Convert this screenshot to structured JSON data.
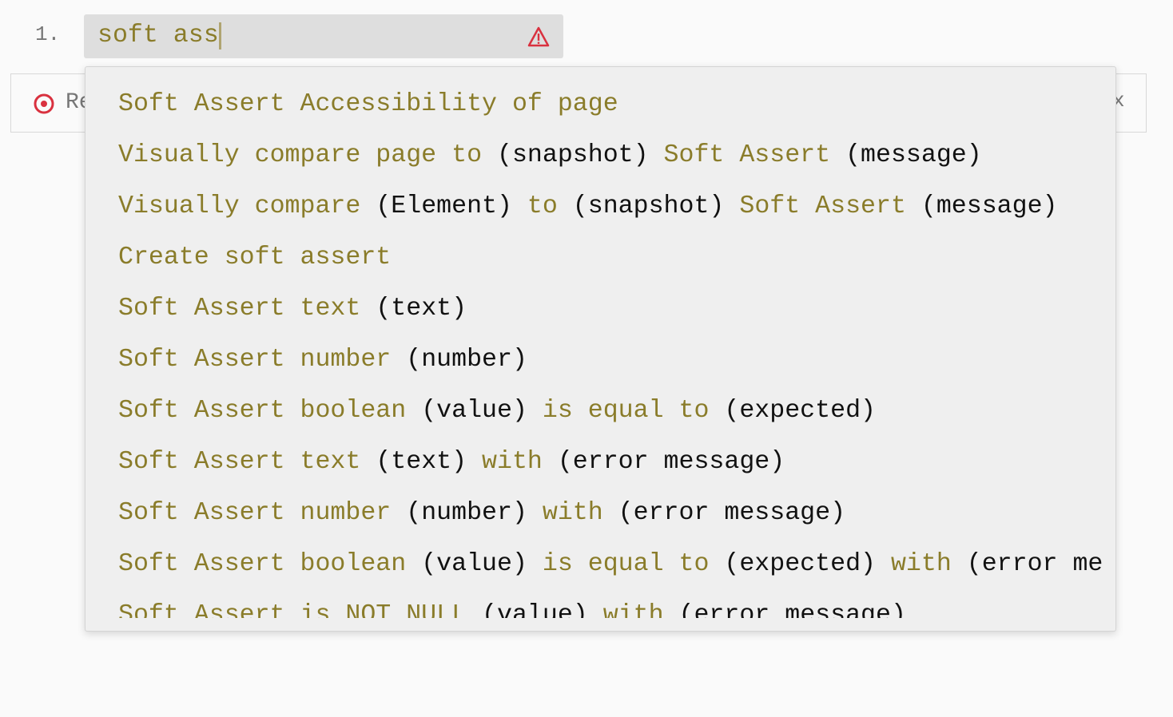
{
  "step_number": "1.",
  "input": {
    "value": "soft ass",
    "warning_icon": "warning-triangle-icon",
    "warning_color": "#d9313f"
  },
  "behind_row": {
    "icon": "target-icon",
    "label": "Re",
    "close": "x"
  },
  "colors": {
    "keyword": "#8a7c2a",
    "parameter": "#111111"
  },
  "suggestions": [
    [
      {
        "t": "Soft Assert Accessibility of page",
        "k": 1
      }
    ],
    [
      {
        "t": "Visually compare page to ",
        "k": 1
      },
      {
        "t": "(snapshot) ",
        "k": 0
      },
      {
        "t": "Soft Assert ",
        "k": 1
      },
      {
        "t": "(message)",
        "k": 0
      }
    ],
    [
      {
        "t": "Visually compare ",
        "k": 1
      },
      {
        "t": "(Element) ",
        "k": 0
      },
      {
        "t": "to ",
        "k": 1
      },
      {
        "t": "(snapshot) ",
        "k": 0
      },
      {
        "t": "Soft Assert ",
        "k": 1
      },
      {
        "t": "(message)",
        "k": 0
      }
    ],
    [
      {
        "t": "Create soft assert",
        "k": 1
      }
    ],
    [
      {
        "t": "Soft Assert text ",
        "k": 1
      },
      {
        "t": "(text)",
        "k": 0
      }
    ],
    [
      {
        "t": "Soft Assert number ",
        "k": 1
      },
      {
        "t": "(number)",
        "k": 0
      }
    ],
    [
      {
        "t": "Soft Assert boolean ",
        "k": 1
      },
      {
        "t": "(value) ",
        "k": 0
      },
      {
        "t": "is equal to ",
        "k": 1
      },
      {
        "t": "(expected)",
        "k": 0
      }
    ],
    [
      {
        "t": "Soft Assert text ",
        "k": 1
      },
      {
        "t": "(text) ",
        "k": 0
      },
      {
        "t": "with ",
        "k": 1
      },
      {
        "t": "(error message)",
        "k": 0
      }
    ],
    [
      {
        "t": "Soft Assert number ",
        "k": 1
      },
      {
        "t": "(number) ",
        "k": 0
      },
      {
        "t": "with ",
        "k": 1
      },
      {
        "t": "(error message)",
        "k": 0
      }
    ],
    [
      {
        "t": "Soft Assert boolean ",
        "k": 1
      },
      {
        "t": "(value) ",
        "k": 0
      },
      {
        "t": "is equal to ",
        "k": 1
      },
      {
        "t": "(expected) ",
        "k": 0
      },
      {
        "t": "with ",
        "k": 1
      },
      {
        "t": "(error message)",
        "k": 0
      }
    ],
    [
      {
        "t": "Soft Assert is NOT NULL ",
        "k": 1
      },
      {
        "t": "(value) ",
        "k": 0
      },
      {
        "t": "with ",
        "k": 1
      },
      {
        "t": "(error message)",
        "k": 0
      }
    ]
  ]
}
